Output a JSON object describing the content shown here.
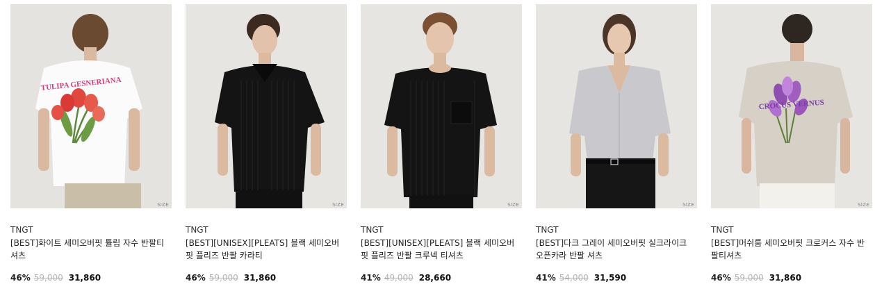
{
  "products": [
    {
      "brand": "TNGT",
      "name": "[BEST]화이트 세미오버핏 튤립 자수 반팔티셔츠",
      "discount": "46%",
      "original_price": "59,000",
      "sale_price": "31,860",
      "size_tag": "SIZE",
      "image": "model-back-white-tee-tulip-print",
      "print_text": "TULIPA GESNERIANA"
    },
    {
      "brand": "TNGT",
      "name": "[BEST][UNISEX][PLEATS] 블랙 세미오버핏 플리즈 반팔 카라티",
      "discount": "46%",
      "original_price": "59,000",
      "sale_price": "31,860",
      "size_tag": "SIZE",
      "image": "model-front-black-pleated-polo"
    },
    {
      "brand": "TNGT",
      "name": "[BEST][UNISEX][PLEATS] 블랙 세미오버핏 플리즈 반팔 크루넥 티셔츠",
      "discount": "41%",
      "original_price": "49,000",
      "sale_price": "28,660",
      "size_tag": "SIZE",
      "image": "model-front-black-pleated-crewneck"
    },
    {
      "brand": "TNGT",
      "name": "[BEST]다크 그레이 세미오버핏 실크라이크 오픈카라 반팔 셔츠",
      "discount": "41%",
      "original_price": "54,000",
      "sale_price": "31,590",
      "size_tag": "SIZE",
      "image": "model-front-grey-open-collar-shirt"
    },
    {
      "brand": "TNGT",
      "name": "[BEST]머쉬룸 세미오버핏 크로커스 자수 반팔티셔츠",
      "discount": "46%",
      "original_price": "59,000",
      "sale_price": "31,860",
      "size_tag": "SIZE",
      "image": "model-back-mushroom-tee-crocus-print",
      "print_text": "CROCUS VERNUS"
    }
  ]
}
